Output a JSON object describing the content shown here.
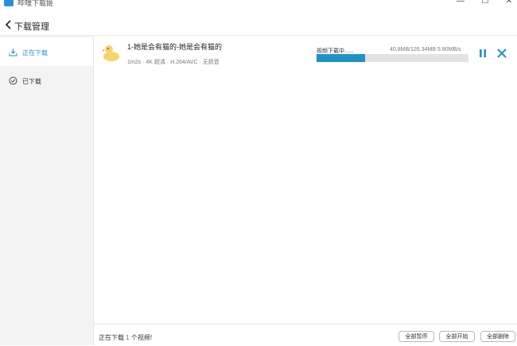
{
  "app": {
    "title": "哔哩下载姬"
  },
  "window_controls": {
    "minimize": "—",
    "maximize": "☐",
    "close": "✕"
  },
  "header": {
    "title": "下载管理"
  },
  "sidebar": {
    "items": [
      {
        "label": "正在下载",
        "icon": "download-icon",
        "active": true
      },
      {
        "label": "已下载",
        "icon": "check-circle-icon",
        "active": false
      }
    ]
  },
  "download": {
    "title": "1-她是会有猫的-她是会有猫的",
    "meta": "1m2s · 4K 超清 · H.264/AVC · 无损音",
    "status": "视频下载中......",
    "stats": "40.8MB/126.34MB 5.90MB/s",
    "progress": 0.32,
    "accent": "#1e93c9"
  },
  "footer": {
    "prefix": "正在下载 ",
    "count": "1",
    "suffix": " 个视频!",
    "pause_all": "全部暂停",
    "start_all": "全部开始",
    "delete_all": "全部删除"
  }
}
